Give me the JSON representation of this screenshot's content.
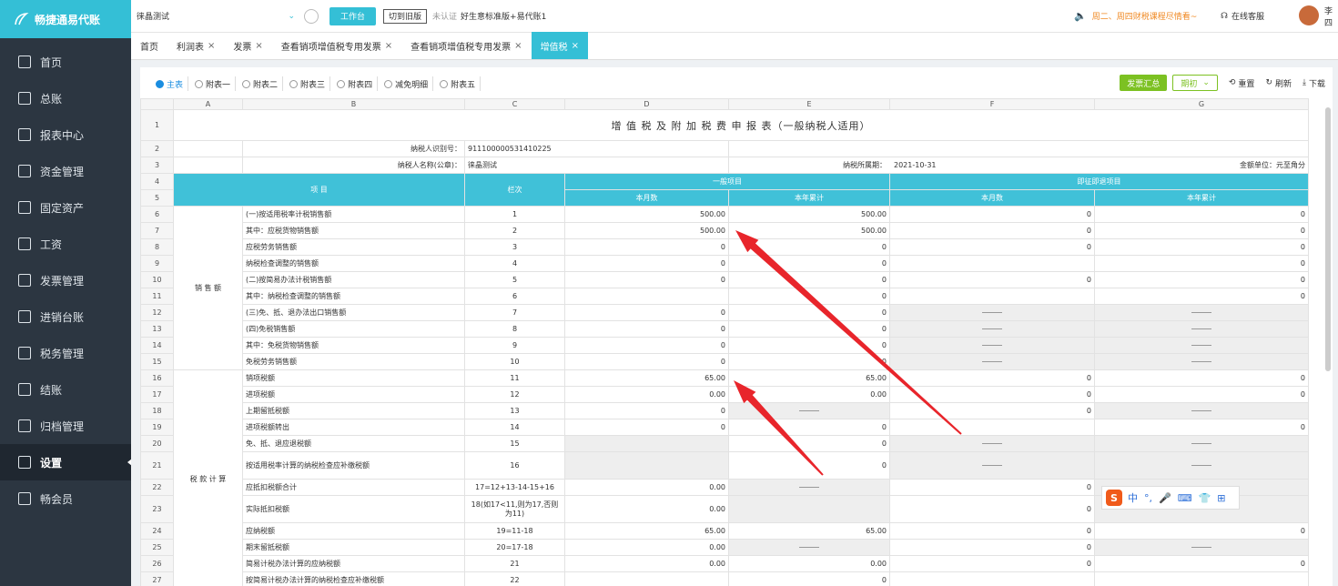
{
  "app": {
    "logo": "畅捷通易代账",
    "company": "徕晶测试",
    "workbench": "工作台",
    "old_version": "切到旧版",
    "uncertified": "未认证",
    "package": "好生意标准版+易代账1",
    "notice": "周二、周四财税课程尽情看~",
    "service": "在线客服",
    "user": "李四"
  },
  "sidebar": {
    "items": [
      {
        "label": "首页"
      },
      {
        "label": "总账"
      },
      {
        "label": "报表中心"
      },
      {
        "label": "资金管理"
      },
      {
        "label": "固定资产"
      },
      {
        "label": "工资"
      },
      {
        "label": "发票管理"
      },
      {
        "label": "进销台账"
      },
      {
        "label": "税务管理"
      },
      {
        "label": "结账"
      },
      {
        "label": "归档管理"
      },
      {
        "label": "设置"
      },
      {
        "label": "畅会员"
      }
    ],
    "active": "设置"
  },
  "tabs": [
    {
      "label": "首页",
      "closable": false
    },
    {
      "label": "利润表",
      "closable": true
    },
    {
      "label": "发票",
      "closable": true
    },
    {
      "label": "查看销项增值税专用发票",
      "closable": true
    },
    {
      "label": "查看销项增值税专用发票",
      "closable": true
    },
    {
      "label": "增值税",
      "closable": true,
      "active": true
    }
  ],
  "subtabs": [
    {
      "label": "主表",
      "active": true
    },
    {
      "label": "附表一"
    },
    {
      "label": "附表二"
    },
    {
      "label": "附表三"
    },
    {
      "label": "附表四"
    },
    {
      "label": "减免明细"
    },
    {
      "label": "附表五"
    }
  ],
  "tools": {
    "summary": "发票汇总",
    "period": "期初",
    "reset": "重置",
    "refresh": "刷新",
    "download": "下载"
  },
  "sheet": {
    "col_letters": [
      "A",
      "B",
      "C",
      "D",
      "E",
      "F",
      "G"
    ],
    "title": "增 值 税 及 附 加 税 费 申 报 表（一般纳税人适用）",
    "taxpayer_id_label": "纳税人识别号：",
    "taxpayer_id": "911100000531410225",
    "taxpayer_name_label": "纳税人名称(公章)：",
    "taxpayer_name": "徕晶测试",
    "period_label": "纳税所属期：",
    "period": "2021-10-31",
    "unit": "金额单位：元至角分",
    "h_item": "项 目",
    "h_col": "栏次",
    "h_general": "一般项目",
    "h_instant": "即征即退项目",
    "h_month": "本月数",
    "h_year": "本年累计",
    "group_sales": "销 售 额",
    "group_tax": "税 款 计 算",
    "rows": [
      {
        "n": "6",
        "item": "(一)按适用税率计税销售额",
        "col": "1",
        "d": "500.00",
        "e": "500.00",
        "f": "0",
        "g": "0"
      },
      {
        "n": "7",
        "item": "其中：应税货物销售额",
        "col": "2",
        "d": "500.00",
        "e": "500.00",
        "f": "0",
        "g": "0"
      },
      {
        "n": "8",
        "item": "应税劳务销售额",
        "col": "3",
        "d": "0",
        "e": "0",
        "f": "0",
        "g": "0"
      },
      {
        "n": "9",
        "item": "纳税检查调整的销售额",
        "col": "4",
        "d": "0",
        "e": "0",
        "f": "",
        "g": "0"
      },
      {
        "n": "10",
        "item": "(二)按简易办法计税销售额",
        "col": "5",
        "d": "0",
        "e": "0",
        "f": "0",
        "g": "0"
      },
      {
        "n": "11",
        "item": "其中：纳税检查调整的销售额",
        "col": "6",
        "d": "",
        "e": "0",
        "f": "",
        "g": "0"
      },
      {
        "n": "12",
        "item": "(三)免、抵、退办法出口销售额",
        "col": "7",
        "d": "0",
        "e": "0",
        "f": "-",
        "g": "-"
      },
      {
        "n": "13",
        "item": "(四)免税销售额",
        "col": "8",
        "d": "0",
        "e": "0",
        "f": "-",
        "g": "-"
      },
      {
        "n": "14",
        "item": "其中：免税货物销售额",
        "col": "9",
        "d": "0",
        "e": "0",
        "f": "-",
        "g": "-"
      },
      {
        "n": "15",
        "item": "免税劳务销售额",
        "col": "10",
        "d": "0",
        "e": "0",
        "f": "-",
        "g": "-"
      },
      {
        "n": "16",
        "item": "销项税额",
        "col": "11",
        "d": "65.00",
        "e": "65.00",
        "f": "0",
        "g": "0"
      },
      {
        "n": "17",
        "item": "进项税额",
        "col": "12",
        "d": "0.00",
        "e": "0.00",
        "f": "0",
        "g": "0"
      },
      {
        "n": "18",
        "item": "上期留抵税额",
        "col": "13",
        "d": "0",
        "e": "-",
        "f": "0",
        "g": "-"
      },
      {
        "n": "19",
        "item": "进项税额转出",
        "col": "14",
        "d": "0",
        "e": "0",
        "f": "",
        "g": "0"
      },
      {
        "n": "20",
        "item": "免、抵、退应退税额",
        "col": "15",
        "d": "",
        "e": "0",
        "f": "-",
        "g": "-"
      },
      {
        "n": "21",
        "item": "按适用税率计算的纳税检查应补缴税额",
        "col": "16",
        "d": "",
        "e": "0",
        "f": "-",
        "g": "-"
      },
      {
        "n": "22",
        "item": "应抵扣税额合计",
        "col": "17=12+13-14-15+16",
        "d": "0.00",
        "e": "-",
        "f": "0",
        "g": ""
      },
      {
        "n": "23",
        "item": "实际抵扣税额",
        "col": "18(如17<11,则为17,否则为11)",
        "d": "0.00",
        "e": "",
        "f": "0",
        "g": ""
      },
      {
        "n": "24",
        "item": "应纳税额",
        "col": "19=11-18",
        "d": "65.00",
        "e": "65.00",
        "f": "0",
        "g": "0"
      },
      {
        "n": "25",
        "item": "期末留抵税额",
        "col": "20=17-18",
        "d": "0.00",
        "e": "-",
        "f": "0",
        "g": "-"
      },
      {
        "n": "26",
        "item": "简易计税办法计算的应纳税额",
        "col": "21",
        "d": "0.00",
        "e": "0.00",
        "f": "0",
        "g": "0"
      },
      {
        "n": "27",
        "item": "按简易计税办法计算的纳税检查应补缴税额",
        "col": "22",
        "d": "",
        "e": "0",
        "f": "",
        "g": ""
      }
    ]
  },
  "ime": {
    "logo": "S",
    "items": [
      "中",
      "°,",
      "🎤",
      "⌨",
      "👕",
      "⊞"
    ]
  },
  "arrow_color": "#e8252b"
}
